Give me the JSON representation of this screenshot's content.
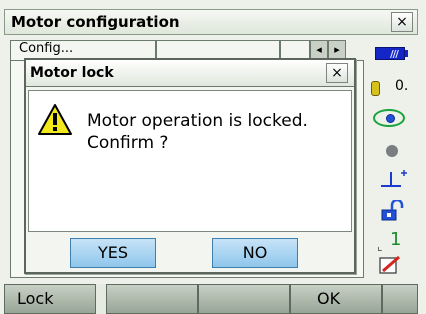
{
  "window": {
    "title": "Motor configuration",
    "close_label": "×"
  },
  "background_tabs": [
    {
      "label": "Config... "
    },
    {
      "label": ""
    },
    {
      "label": ""
    }
  ],
  "status_icons": {
    "battery": "battery-icon",
    "battery_text": "///",
    "prism": "prism-icon",
    "prism_constant": "0.",
    "tilt": "tilt-icon",
    "circle": "circle-icon",
    "target": "target-icon",
    "lock": "lock-icon",
    "index": "index-icon",
    "index_value": "1",
    "edit": "edit-icon"
  },
  "dialog": {
    "title": "Motor lock",
    "close_label": "×",
    "icon": "warning-icon",
    "message_line1": "Motor operation is locked.",
    "message_line2": "Confirm ?",
    "buttons": {
      "yes": "YES",
      "no": "NO"
    }
  },
  "softkeys": [
    {
      "label": "Lock"
    },
    {
      "label": ""
    },
    {
      "label": ""
    },
    {
      "label": "OK"
    }
  ],
  "colors": {
    "dialog_button": "#a9d5f3",
    "battery": "#1526c9",
    "tilt": "#1ba33e"
  }
}
